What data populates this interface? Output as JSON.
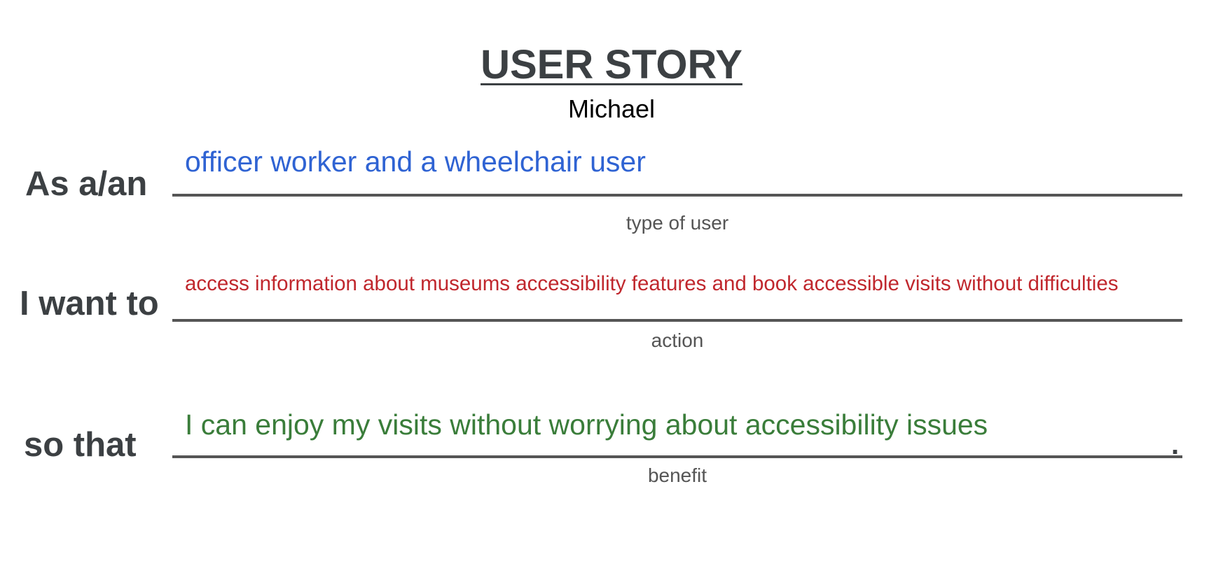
{
  "title": "USER STORY",
  "author": "Michael",
  "rows": [
    {
      "label": "As a/an",
      "value": "officer worker and a wheelchair user",
      "caption": "type of user",
      "color": "#2f63d3"
    },
    {
      "label": "I want to",
      "value": "access information about museums accessibility features and book accessible visits without difficulties",
      "caption": "action",
      "color": "#c0272d"
    },
    {
      "label": "so that",
      "value": "I can enjoy my visits without worrying about accessibility issues",
      "caption": "benefit",
      "color": "#3a7d3a"
    }
  ],
  "end_punctuation": "."
}
